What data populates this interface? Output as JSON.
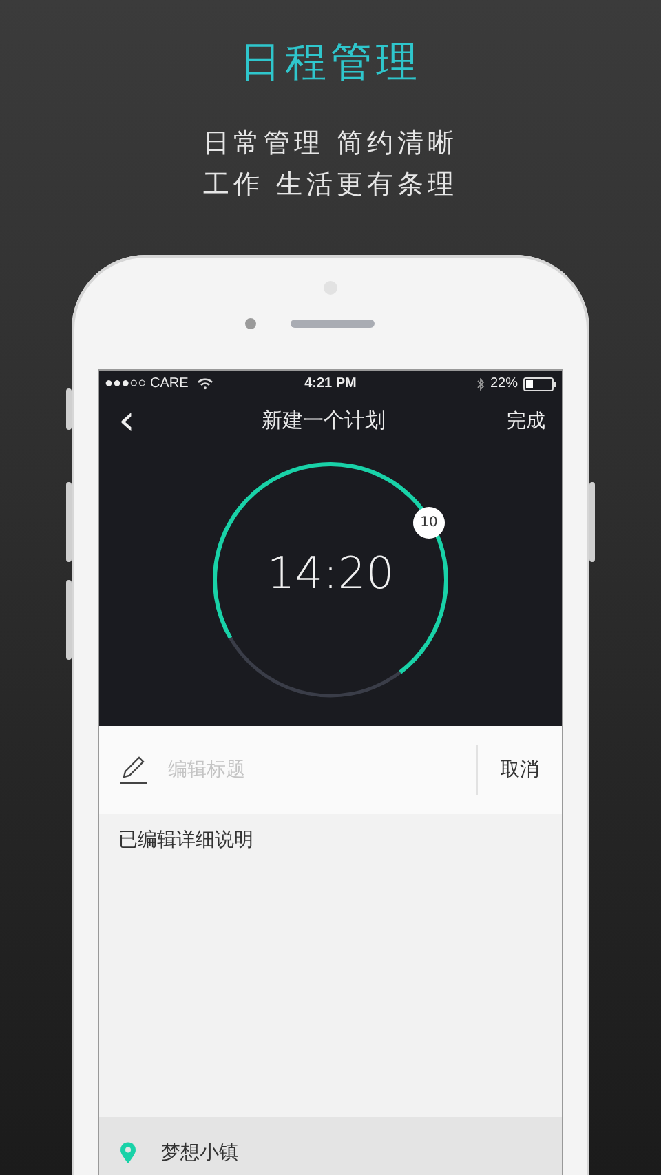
{
  "headline": "日程管理",
  "taglines": [
    "日常管理 简约清晰",
    "工作 生活更有条理"
  ],
  "status_bar": {
    "carrier": "●●●○○ CARE",
    "time": "4:21 PM",
    "battery": "22%"
  },
  "nav": {
    "back": "‹",
    "title": "新建一个计划",
    "done": "完成"
  },
  "dial": {
    "time": "14:20",
    "minute_badge": "10"
  },
  "title_field": {
    "placeholder": "编辑标题",
    "cancel": "取消"
  },
  "description": "已编辑详细说明",
  "location": "梦想小镇"
}
